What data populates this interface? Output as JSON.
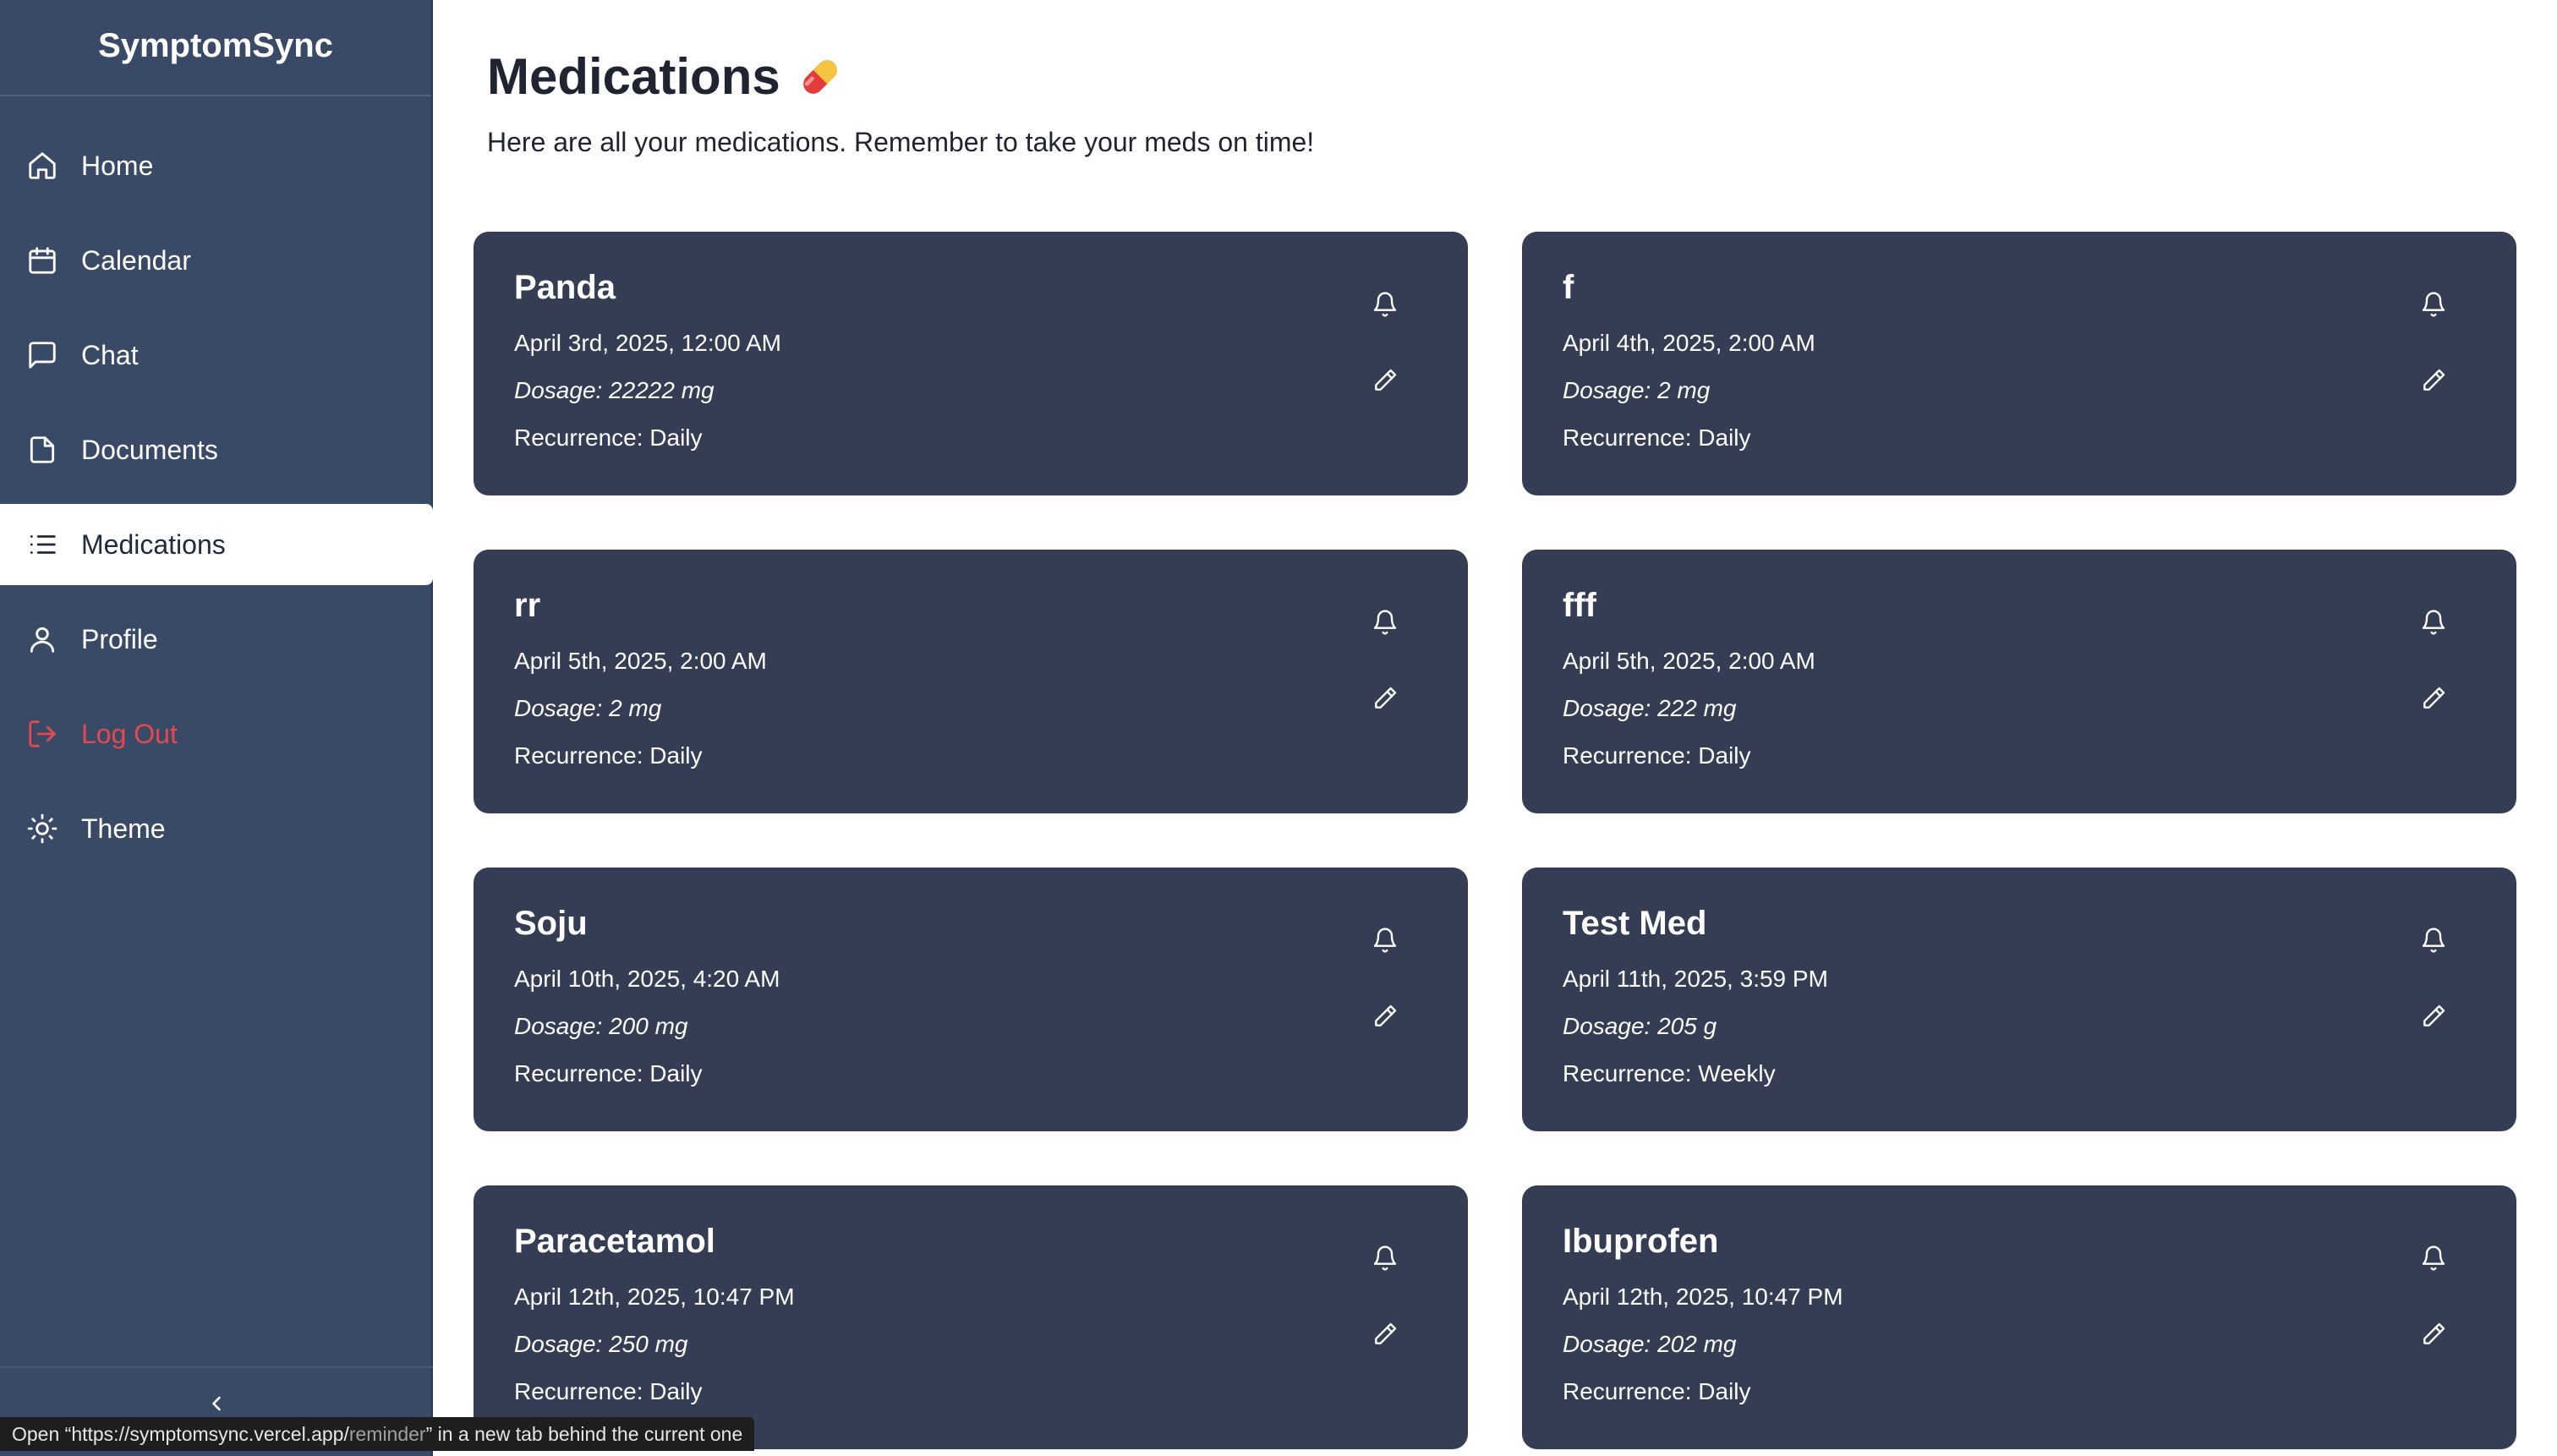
{
  "app": {
    "title": "SymptomSync"
  },
  "sidebar": {
    "items": [
      {
        "label": "Home",
        "icon": "home-icon"
      },
      {
        "label": "Calendar",
        "icon": "calendar-icon"
      },
      {
        "label": "Chat",
        "icon": "chat-icon"
      },
      {
        "label": "Documents",
        "icon": "document-icon"
      },
      {
        "label": "Medications",
        "icon": "list-icon",
        "active": true
      },
      {
        "label": "Profile",
        "icon": "user-icon"
      },
      {
        "label": "Log Out",
        "icon": "logout-icon"
      },
      {
        "label": "Theme",
        "icon": "sun-icon"
      }
    ],
    "collapse_icon": "chevron-left-icon"
  },
  "page": {
    "title": "Medications",
    "title_icon": "pill-icon",
    "subtitle": "Here are all your medications. Remember to take your meds on time!"
  },
  "medications": [
    {
      "name": "Panda",
      "date": "April 3rd, 2025, 12:00 AM",
      "dosage": "Dosage: 22222 mg",
      "recurrence": "Recurrence: Daily"
    },
    {
      "name": "f",
      "date": "April 4th, 2025, 2:00 AM",
      "dosage": "Dosage: 2 mg",
      "recurrence": "Recurrence: Daily"
    },
    {
      "name": "rr",
      "date": "April 5th, 2025, 2:00 AM",
      "dosage": "Dosage: 2 mg",
      "recurrence": "Recurrence: Daily"
    },
    {
      "name": "fff",
      "date": "April 5th, 2025, 2:00 AM",
      "dosage": "Dosage: 222 mg",
      "recurrence": "Recurrence: Daily"
    },
    {
      "name": "Soju",
      "date": "April 10th, 2025, 4:20 AM",
      "dosage": "Dosage: 200 mg",
      "recurrence": "Recurrence: Daily"
    },
    {
      "name": "Test Med",
      "date": "April 11th, 2025, 3:59 PM",
      "dosage": "Dosage: 205 g",
      "recurrence": "Recurrence: Weekly"
    },
    {
      "name": "Paracetamol",
      "date": "April 12th, 2025, 10:47 PM",
      "dosage": "Dosage: 250 mg",
      "recurrence": "Recurrence: Daily"
    },
    {
      "name": "Ibuprofen",
      "date": "April 12th, 2025, 10:47 PM",
      "dosage": "Dosage: 202 mg",
      "recurrence": "Recurrence: Daily"
    }
  ],
  "status_bar": {
    "prefix": "Open “https://symptomsync.vercel.app/",
    "path": "reminder",
    "suffix": "” in a new tab behind the current one"
  },
  "colors": {
    "sidebar_bg": "#384a66",
    "card_bg": "#343d54",
    "logout_red": "#e5484d"
  }
}
